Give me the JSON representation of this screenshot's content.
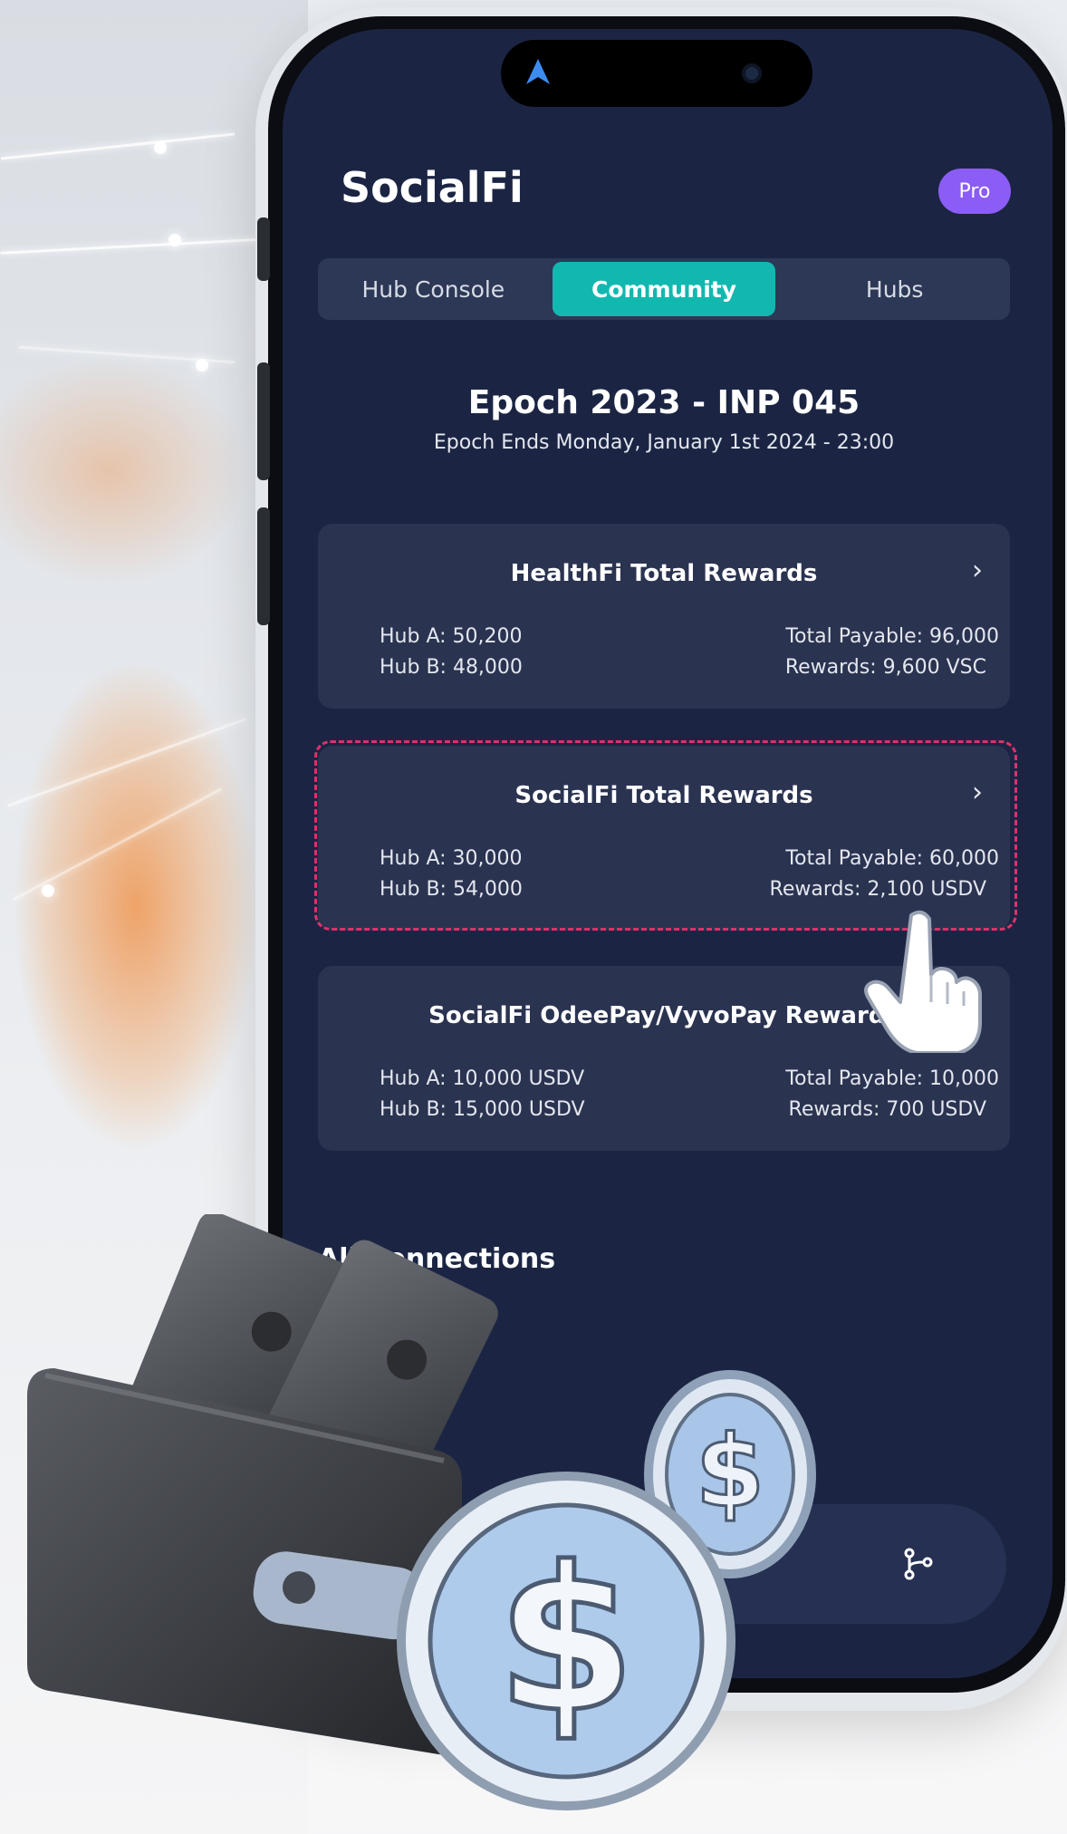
{
  "app": {
    "title": "SocialFi",
    "badge": "Pro"
  },
  "tabs": [
    {
      "label": "Hub Console",
      "active": false
    },
    {
      "label": "Community",
      "active": true
    },
    {
      "label": "Hubs",
      "active": false
    }
  ],
  "epoch": {
    "title": "Epoch 2023 - INP 045",
    "subtitle": "Epoch Ends Monday, January 1st 2024 - 23:00"
  },
  "cards": [
    {
      "title": "HealthFi Total Rewards",
      "hub_a": "Hub A: 50,200",
      "hub_b": "Hub B: 48,000",
      "total_payable": "Total Payable: 96,000",
      "rewards": "Rewards: 9,600 VSC"
    },
    {
      "title": "SocialFi Total Rewards",
      "hub_a": "Hub A: 30,000",
      "hub_b": "Hub B: 54,000",
      "total_payable": "Total Payable: 60,000",
      "rewards": "Rewards: 2,100 USDV"
    },
    {
      "title": "SocialFi OdeePay/VyvoPay Rewards",
      "hub_a": "Hub A: 10,000 USDV",
      "hub_b": "Hub B: 15,000 USDV",
      "total_payable": "Total Payable: 10,000",
      "rewards": "Rewards: 700 USDV"
    }
  ],
  "connections_heading": "All Connections",
  "colors": {
    "screen_bg": "#1b2543",
    "card_bg": "#2a3350",
    "tab_active": "#12b8b0",
    "badge": "#8b5cf6",
    "highlight_border": "#e0306a"
  },
  "icons": [
    "app-logo-icon",
    "camera-icon",
    "chevron-right-icon",
    "pointing-hand-cursor-icon",
    "share-network-icon",
    "wallet-illustration",
    "coin-illustration"
  ]
}
